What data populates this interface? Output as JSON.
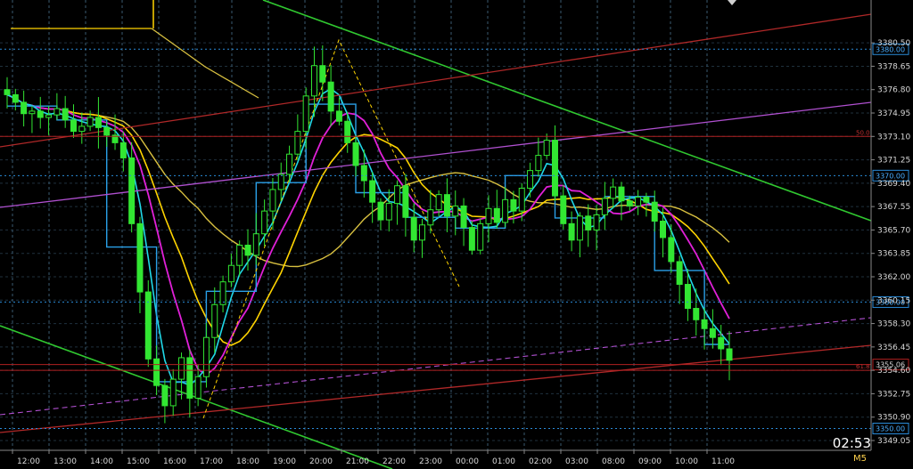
{
  "chart_data": {
    "type": "candlestick",
    "symbol_timeframe": "M5",
    "countdown": "02:53",
    "ylim": [
      3349.05,
      3382.2
    ],
    "price_ticks": [
      "3380.50",
      "3378.65",
      "3376.80",
      "3374.95",
      "3373.10",
      "3371.25",
      "3369.40",
      "3367.55",
      "3365.70",
      "3363.85",
      "3362.00",
      "3360.15",
      "3358.30",
      "3356.45",
      "3354.60",
      "3352.75",
      "3350.90",
      "3349.05"
    ],
    "time_labels": [
      "12:00",
      "13:00",
      "14:00",
      "15:00",
      "16:00",
      "17:00",
      "18:00",
      "19:00",
      "20:00",
      "21:00",
      "22:00",
      "23:00",
      "00:00",
      "01:00",
      "02:00",
      "03:00",
      "08:00",
      "09:00",
      "10:00",
      "11:00"
    ],
    "horizontal_levels": [
      {
        "price": 3380.0,
        "label": "3380.00",
        "color": "#2a8bd8"
      },
      {
        "price": 3370.0,
        "label": "3370.00",
        "color": "#2a8bd8"
      },
      {
        "price": 3360.0,
        "label": "3360.00",
        "color": "#2a8bd8"
      },
      {
        "price": 3350.0,
        "label": "3350.00",
        "color": "#2a8bd8"
      },
      {
        "price": 3373.1,
        "label": "50.0",
        "color": "#b02020"
      },
      {
        "price": 3354.6,
        "label": "61.8",
        "color": "#b02020"
      },
      {
        "price": 3355.06,
        "label": "3355.06",
        "color": "#b02020"
      }
    ],
    "colors": {
      "candles": "#32e632",
      "cyan_ma": "#20d8e8",
      "magenta_ma": "#e020d8",
      "yellow_ma": "#ffd400",
      "khaki_ma": "#d8c040",
      "step_line": "#2aa0e8",
      "channel_green": "#30c830",
      "channel_red": "#b02828",
      "trend_violet": "#b050d0",
      "grid": "#3a5a70"
    },
    "closes": [
      3376.4,
      3375.8,
      3374.9,
      3375.1,
      3374.6,
      3374.8,
      3375.3,
      3374.4,
      3373.5,
      3373.9,
      3374.6,
      3373.8,
      3373.2,
      3372.6,
      3371.4,
      3366.2,
      3360.8,
      3355.5,
      3353.4,
      3351.8,
      3353.9,
      3355.6,
      3352.4,
      3354.1,
      3357.2,
      3359.8,
      3361.6,
      3362.9,
      3364.5,
      3363.7,
      3365.4,
      3367.2,
      3368.9,
      3370.1,
      3371.7,
      3373.5,
      3376.3,
      3378.7,
      3377.4,
      3375.1,
      3374.3,
      3372.6,
      3370.8,
      3369.6,
      3367.9,
      3366.5,
      3367.8,
      3369.2,
      3366.7,
      3364.9,
      3366.1,
      3367.3,
      3368.5,
      3366.8,
      3367.6,
      3365.9,
      3364.1,
      3366.2,
      3367.4,
      3366.3,
      3368.1,
      3367.2,
      3369.0,
      3370.4,
      3371.6,
      3372.8,
      3368.4,
      3366.2,
      3364.9,
      3366.8,
      3365.7,
      3366.9,
      3368.2,
      3369.1,
      3368.0,
      3367.6,
      3368.3,
      3367.9,
      3366.4,
      3365.1,
      3363.2,
      3361.4,
      3359.5,
      3358.6,
      3357.9,
      3357.2,
      3356.3,
      3355.4
    ]
  }
}
